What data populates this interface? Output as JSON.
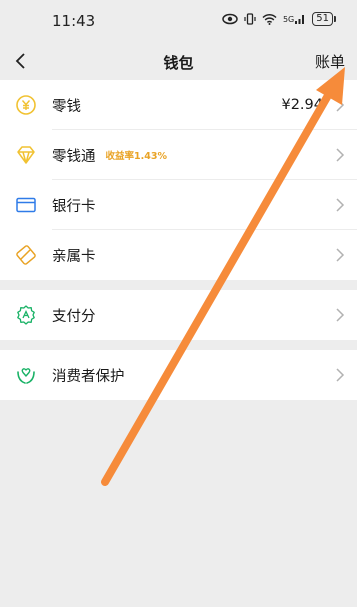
{
  "status_bar": {
    "time": "11:43",
    "network_label": "5G",
    "battery": "51"
  },
  "nav": {
    "title": "钱包",
    "right_action": "账单"
  },
  "groups": [
    {
      "items": [
        {
          "label": "零钱",
          "value": "¥2.94",
          "icon": "coin-icon",
          "color": "#f1c232"
        },
        {
          "label": "零钱通",
          "tag": "收益率1.43%",
          "icon": "diamond-icon",
          "color": "#f1c232"
        },
        {
          "label": "银行卡",
          "icon": "card-icon",
          "color": "#2f7be8"
        },
        {
          "label": "亲属卡",
          "icon": "family-card-icon",
          "color": "#e9a325"
        }
      ]
    },
    {
      "items": [
        {
          "label": "支付分",
          "icon": "pay-score-icon",
          "color": "#19b266"
        }
      ]
    },
    {
      "items": [
        {
          "label": "消费者保护",
          "icon": "protection-icon",
          "color": "#19b266"
        }
      ]
    }
  ],
  "annotation": {
    "color": "#f68b3a"
  }
}
